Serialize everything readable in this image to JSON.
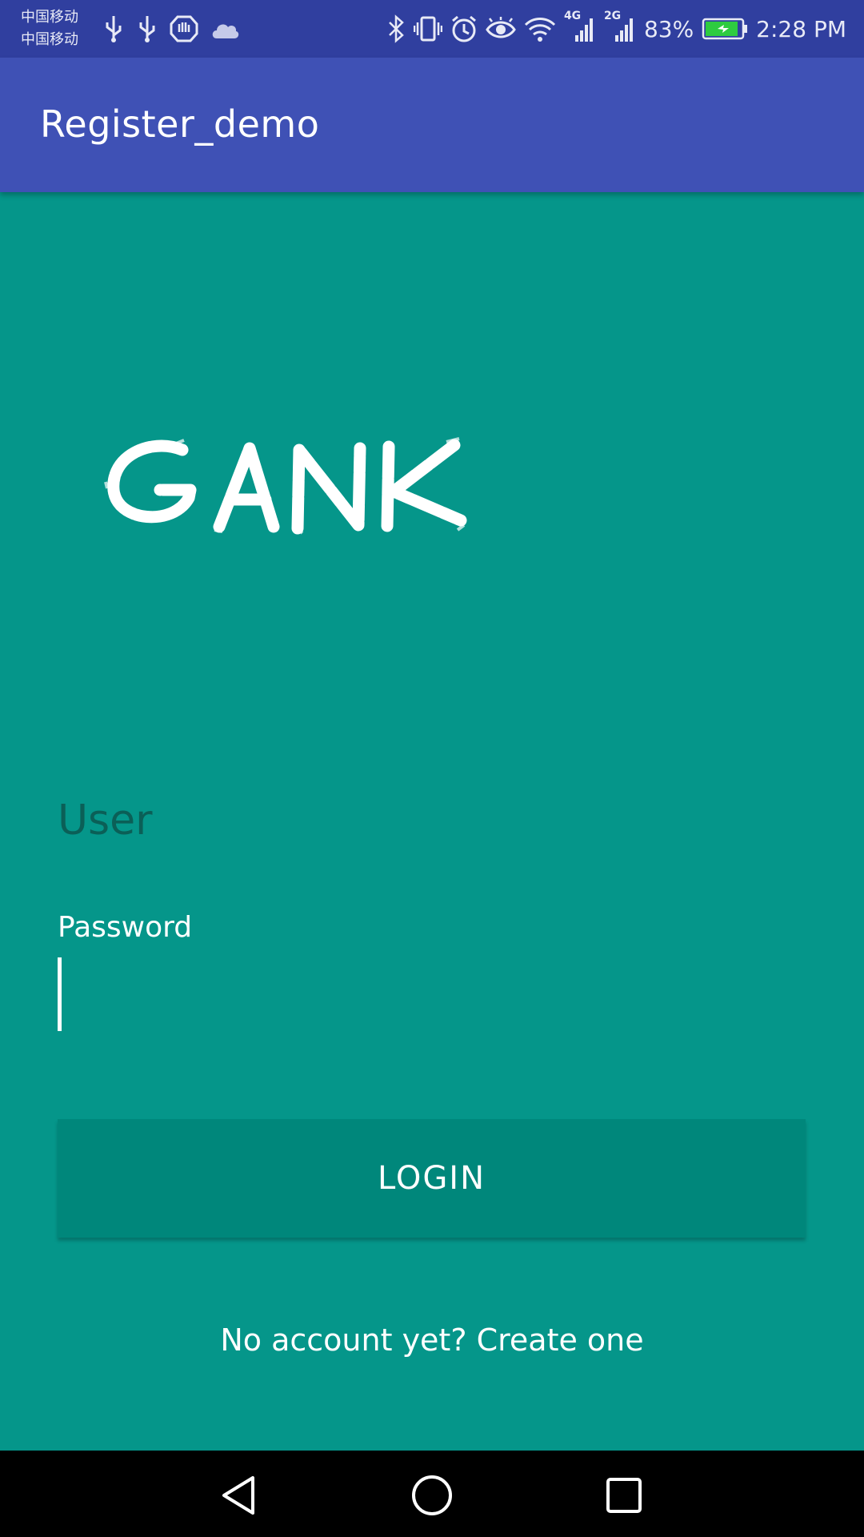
{
  "status_bar": {
    "carrier_1": "中国移动",
    "carrier_2": "中国移动",
    "network_4g": "4G",
    "network_2g": "2G",
    "battery": "83%",
    "time": "2:28 PM"
  },
  "app_bar": {
    "title": "Register_demo"
  },
  "logo": {
    "text": "GANK"
  },
  "form": {
    "user_hint": "User",
    "password_label": "Password",
    "password_value": ""
  },
  "login_button": {
    "label": "LOGIN"
  },
  "signup_link": {
    "label": "No account yet? Create one"
  },
  "colors": {
    "status_bar": "#303F9F",
    "app_bar": "#3F51B5",
    "background": "#05968A",
    "button": "#00877B",
    "hint_text": "#0B5F57"
  },
  "nav_bar": {
    "icons": [
      "back-icon",
      "home-icon",
      "recents-icon"
    ]
  }
}
